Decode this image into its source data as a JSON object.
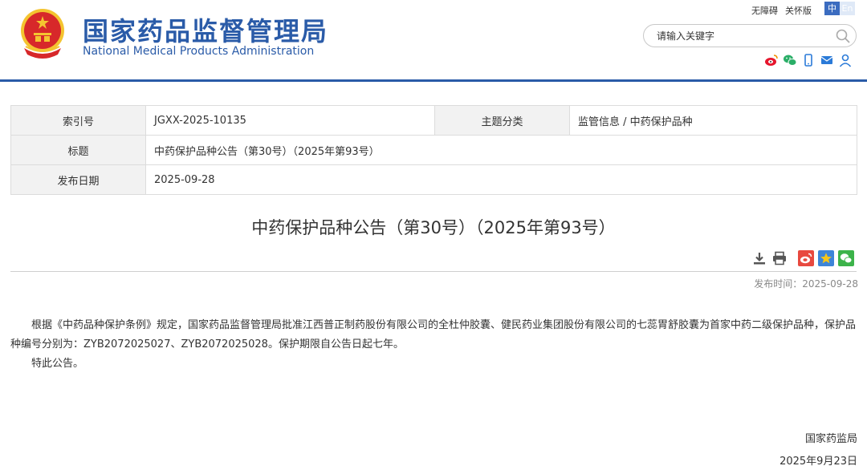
{
  "header": {
    "title_cn": "国家药品监督管理局",
    "title_en": "National Medical Products Administration",
    "links": {
      "accessibility": "无障碍",
      "care": "关怀版"
    },
    "lang": {
      "cn": "中",
      "en": "En"
    },
    "search": {
      "placeholder": "请输入关键字"
    },
    "social_icons": [
      "weibo-icon",
      "wechat-icon",
      "mobile-icon",
      "mail-icon",
      "user-icon"
    ]
  },
  "info_table": {
    "index_label": "索引号",
    "index_value": "JGXX-2025-10135",
    "category_label": "主题分类",
    "category_value": "监管信息 / 中药保护品种",
    "title_label": "标题",
    "title_value": "中药保护品种公告（第30号）（2025年第93号）",
    "date_label": "发布日期",
    "date_value": "2025-09-28"
  },
  "article": {
    "title": "中药保护品种公告（第30号）（2025年第93号）",
    "tools": [
      "download-icon",
      "print-icon",
      "share-weibo-icon",
      "favorite-icon",
      "share-wechat-icon"
    ],
    "publish_time": "发布时间：2025-09-28",
    "body": [
      "根据《中药品种保护条例》规定，国家药品监督管理局批准江西普正制药股份有限公司的全杜仲胶囊、健民药业集团股份有限公司的七蕊胃舒胶囊为首家中药二级保护品种，保护品种编号分别为：ZYB2072025027、ZYB2072025028。保护期限自公告日起七年。",
      "特此公告。"
    ],
    "signature": "国家药监局",
    "sign_date": "2025年9月23日"
  },
  "colors": {
    "brand_blue": "#2a5ba8",
    "emblem_red": "#d7282a",
    "emblem_gold": "#f4c430"
  }
}
